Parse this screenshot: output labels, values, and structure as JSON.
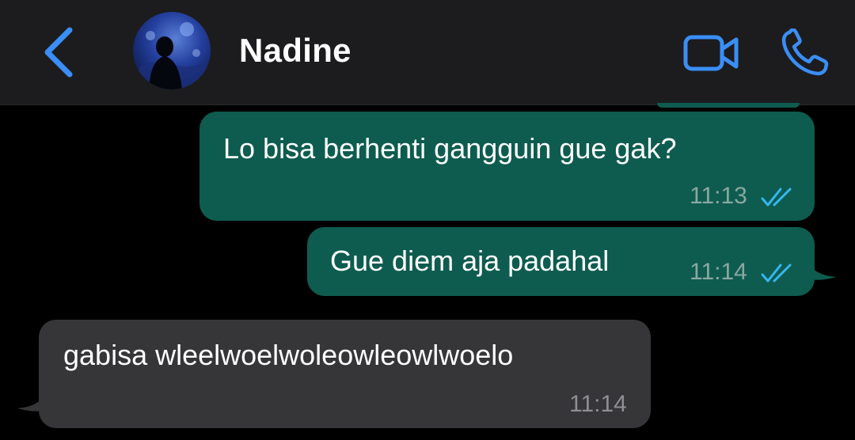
{
  "header": {
    "contact_name": "Nadine",
    "accent_color": "#3a8ef5",
    "icons": {
      "back": "chevron-left-icon",
      "video": "video-camera-icon",
      "call": "phone-icon"
    }
  },
  "messages": [
    {
      "direction": "outgoing",
      "text": "Lo bisa berhenti gangguin gue gak?",
      "time": "11:13",
      "status": "read"
    },
    {
      "direction": "outgoing",
      "text": "Gue diem aja padahal",
      "time": "11:14",
      "status": "read"
    },
    {
      "direction": "incoming",
      "text": "gabisa wleelwoelwoleowleowlwoelo",
      "time": "11:14"
    }
  ],
  "colors": {
    "outgoing_bubble": "#0e5c4f",
    "incoming_bubble": "#363638",
    "read_ticks": "#34b7f1"
  }
}
